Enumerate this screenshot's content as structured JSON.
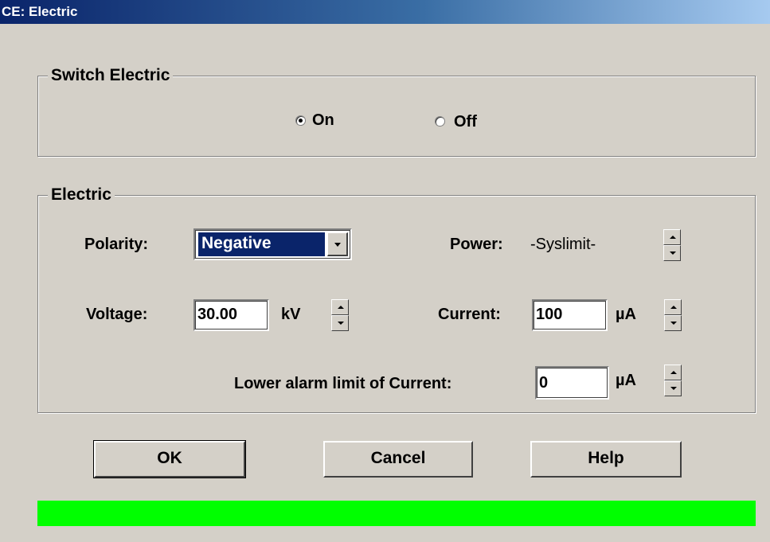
{
  "window": {
    "title": "CE: Electric"
  },
  "switch_group": {
    "legend": "Switch Electric",
    "on_label": "On",
    "off_label": "Off",
    "selected": "On"
  },
  "electric_group": {
    "legend": "Electric",
    "polarity_label": "Polarity:",
    "polarity_value": "Negative",
    "power_label": "Power:",
    "power_value": "-Syslimit-",
    "voltage_label": "Voltage:",
    "voltage_value": "30.00",
    "voltage_unit": "kV",
    "current_label": "Current:",
    "current_value": "100",
    "current_unit": "µA",
    "lower_alarm_label": "Lower alarm limit of Current:",
    "lower_alarm_value": "0",
    "lower_alarm_unit": "µA"
  },
  "buttons": {
    "ok": "OK",
    "cancel": "Cancel",
    "help": "Help"
  },
  "status": {
    "color": "#00ff00"
  },
  "icons": {
    "dropdown": "chevron-down-icon",
    "spin_up": "arrow-up-icon",
    "spin_down": "arrow-down-icon"
  }
}
